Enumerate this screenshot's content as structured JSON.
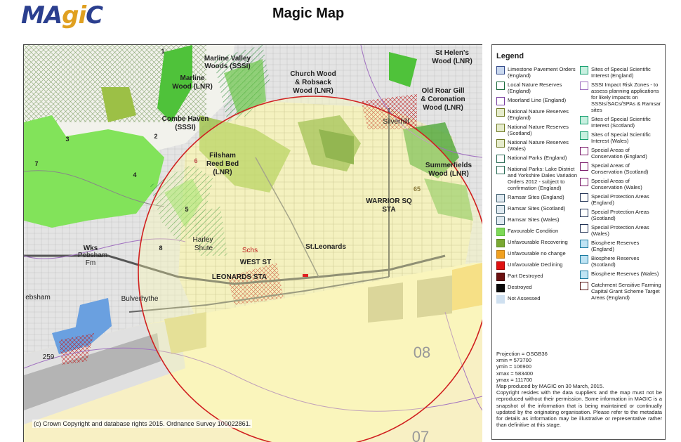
{
  "header": {
    "logo_left": "MA",
    "logo_mid": "gi",
    "logo_right": "C",
    "title": "Magic Map"
  },
  "map": {
    "copyright": "(c) Crown Copyright and database rights 2015. Ordnance Survey 100022861.",
    "labels": {
      "marline_valley": "Marline Valley",
      "woods_sssi": "Woods (SSSI)",
      "marline": "Marline",
      "wood_lnr": "Wood (LNR)",
      "church_wood": "Church Wood",
      "robsack": "& Robsack",
      "robsack_wood": "Wood (LNR)",
      "st_helens": "St Helen's",
      "st_helens_wood": "Wood (LNR)",
      "old_roar": "Old Roar Gill",
      "coronation": "& Coronation",
      "coronation_wood": "Wood (LNR)",
      "combe_haven": "Combe Haven",
      "combe_sssi": "(SSSI)",
      "filsham": "Filsham",
      "reed_bed": "Reed Bed",
      "reed_lnr": "(LNR)",
      "summerfields": "Summerfields",
      "summer_wood": "Wood (LNR)",
      "warrior_sq": "WARRIOR SQ",
      "sta": "STA",
      "st_leonards": "St.Leonards",
      "west_st": "WEST ST",
      "leonards_sta": "LEONARDS STA",
      "harley": "Harley",
      "shute": "Shute",
      "schs": "Schs",
      "wks": "Wks",
      "pebsham": "Pebsham",
      "fm": "Fm",
      "bulverhythe": "Bulverhythe",
      "ebsham": "ebsham",
      "silverhill": "Silverhill",
      "grid_08": "08",
      "grid_07": "07",
      "grid_259": "259",
      "n1": "1",
      "n2": "2",
      "n3": "3",
      "n4": "4",
      "n5": "5",
      "n6": "6",
      "n7": "7",
      "n8": "8",
      "n65": "65"
    }
  },
  "legend": {
    "title": "Legend",
    "col1": [
      {
        "label": "Limestone Pavement Orders (England)",
        "icon": "limestone-swatch",
        "fill": "#c9d8ef",
        "border": "#334a8a"
      },
      {
        "label": "Local Nature Reserves (England)",
        "icon": "lnr-swatch",
        "fill": "#ffffff",
        "border": "#1a6b3a"
      },
      {
        "label": "Moorland Line (England)",
        "icon": "moorland-swatch",
        "fill": "#ffffff",
        "border": "#7a3fa0"
      },
      {
        "label": "National Nature Reserves (England)",
        "icon": "nnr-swatch",
        "fill": "#e6eccc",
        "border": "#6f7a25"
      },
      {
        "label": "National Nature Reserves (Scotland)",
        "icon": "nnr-scot-swatch",
        "fill": "#e6eccc",
        "border": "#6f7a25"
      },
      {
        "label": "National Nature Reserves (Wales)",
        "icon": "nnr-wales-swatch",
        "fill": "#e6eccc",
        "border": "#6f7a25"
      },
      {
        "label": "National Parks (England)",
        "icon": "np-swatch",
        "fill": "#ffffff",
        "border": "#2b6b55"
      },
      {
        "label": "National Parks: Lake District and Yorkshire Dales Variation Orders 2012 - subject to confirmation (England)",
        "icon": "np-variation-swatch",
        "fill": "#ffffff",
        "border": "#2b6b55"
      },
      {
        "label": "Ramsar Sites (England)",
        "icon": "ramsar-swatch",
        "fill": "#dfe9f0",
        "border": "#3a5a6a"
      },
      {
        "label": "Ramsar Sites (Scotland)",
        "icon": "ramsar-scot-swatch",
        "fill": "#dfe9f0",
        "border": "#3a5a6a"
      },
      {
        "label": "Ramsar Sites (Wales)",
        "icon": "ramsar-wales-swatch",
        "fill": "#dfe9f0",
        "border": "#3a5a6a"
      },
      {
        "label": "Favourable Condition",
        "icon": "favourable-swatch",
        "fill": "#7ed957",
        "border": "#5ab83a"
      },
      {
        "label": "Unfavourable Recovering",
        "icon": "recovering-swatch",
        "fill": "#7aa833",
        "border": "#5a8a20"
      },
      {
        "label": "Unfavourable no change",
        "icon": "nochange-swatch",
        "fill": "#f0a020",
        "border": "#c07a10"
      },
      {
        "label": "Unfavourable Declining",
        "icon": "declining-swatch",
        "fill": "#e01010",
        "border": "#a00000"
      },
      {
        "label": "Part Destroyed",
        "icon": "part-destroyed-swatch",
        "fill": "#6b1010",
        "border": "#400000"
      },
      {
        "label": "Destroyed",
        "icon": "destroyed-swatch",
        "fill": "#0a0a0a",
        "border": "#000000"
      },
      {
        "label": "Not Assessed",
        "icon": "not-assessed-swatch",
        "fill": "#cfe0f0",
        "border": "#cfe0f0"
      }
    ],
    "col2": [
      {
        "label": "Sites of Special Scientific Interest (England)",
        "icon": "sssi-swatch",
        "fill": "#c8f0e0",
        "border": "#18a070"
      },
      {
        "label": "SSSI Impact Risk Zones - to assess planning applications for likely impacts on SSSIs/SACs/SPAs & Ramsar sites",
        "icon": "irz-swatch",
        "fill": "#ffffff",
        "border": "#a070c0"
      },
      {
        "label": "Sites of Special Scientific Interest (Scotland)",
        "icon": "sssi-scot-swatch",
        "fill": "#c8f0e0",
        "border": "#18a070"
      },
      {
        "label": "Sites of Special Scientific Interest (Wales)",
        "icon": "sssi-wales-swatch",
        "fill": "#c8f0e0",
        "border": "#18a070"
      },
      {
        "label": "Special Areas of Conservation (England)",
        "icon": "sac-swatch",
        "fill": "#ffffff",
        "border": "#7a1a6a"
      },
      {
        "label": "Special Areas of Conservation (Scotland)",
        "icon": "sac-scot-swatch",
        "fill": "#ffffff",
        "border": "#7a1a6a"
      },
      {
        "label": "Special Areas of Conservation (Wales)",
        "icon": "sac-wales-swatch",
        "fill": "#ffffff",
        "border": "#7a1a6a"
      },
      {
        "label": "Special Protection Areas (England)",
        "icon": "spa-swatch",
        "fill": "#ffffff",
        "border": "#223355"
      },
      {
        "label": "Special Protection Areas (Scotland)",
        "icon": "spa-scot-swatch",
        "fill": "#ffffff",
        "border": "#223355"
      },
      {
        "label": "Special Protection Areas (Wales)",
        "icon": "spa-wales-swatch",
        "fill": "#ffffff",
        "border": "#223355"
      },
      {
        "label": "Biosphere Reserves (England)",
        "icon": "biosphere-swatch",
        "fill": "#bfe4f4",
        "border": "#1a7aa0"
      },
      {
        "label": "Biosphere Reserves (Scotland)",
        "icon": "biosphere-scot-swatch",
        "fill": "#bfe4f4",
        "border": "#1a7aa0"
      },
      {
        "label": "Biosphere Reserves (Wales)",
        "icon": "biosphere-wales-swatch",
        "fill": "#bfe4f4",
        "border": "#1a7aa0"
      },
      {
        "label": "Catchment Sensitive Farming Capital Grant Scheme Target Areas (England)",
        "icon": "csf-swatch",
        "fill": "#ffffff",
        "border": "#5a1a1a"
      }
    ],
    "meta": {
      "projection": "Projection = OSGB36",
      "xmin": "xmin = 573700",
      "ymin": "ymin = 106900",
      "xmax": "xmax = 583400",
      "ymax": "ymax = 111700",
      "produced": "Map produced by MAGIC on 30 March, 2015.",
      "disclaimer": "Copyright resides with the data suppliers and the map must not be reproduced without their permission. Some information in MAGIC is a snapshot of the information that is being maintained or continually updated by the originating organisation. Please refer to the metadata for details as information may be illustrative or representative rather than definitive at this stage."
    }
  }
}
